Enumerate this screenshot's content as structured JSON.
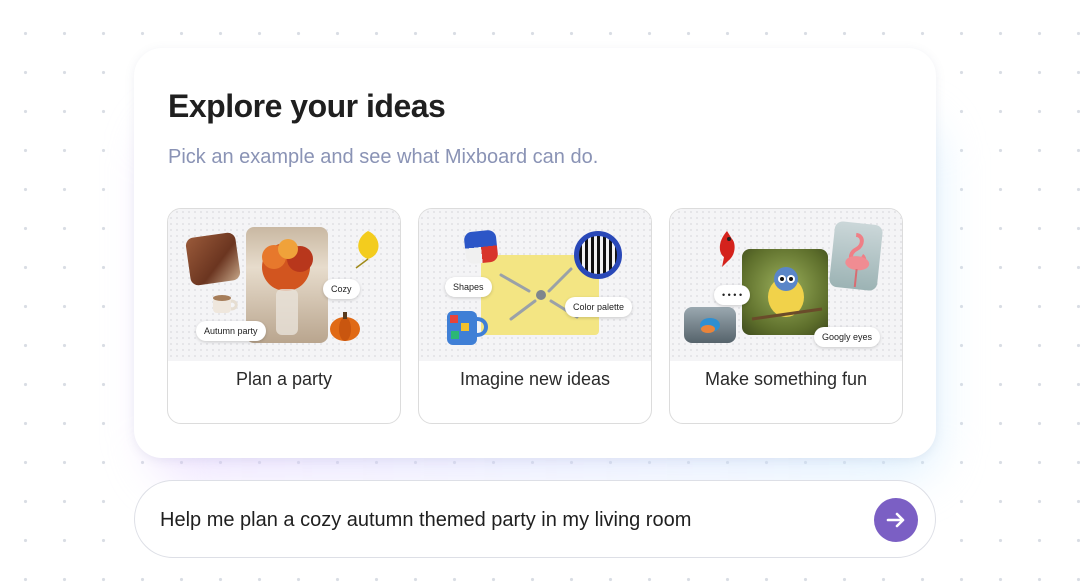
{
  "explore": {
    "title": "Explore your ideas",
    "subtitle": "Pick an example and see what Mixboard can do."
  },
  "examples": [
    {
      "label": "Plan a party",
      "chips": [
        "Cozy",
        "Autumn party"
      ]
    },
    {
      "label": "Imagine new ideas",
      "chips": [
        "Shapes",
        "Color palette"
      ]
    },
    {
      "label": "Make something fun",
      "chips": [
        "Googly eyes",
        "• • • •"
      ]
    }
  ],
  "prompt": {
    "value": "Help me plan a cozy autumn themed party in my living room",
    "send_icon": "arrow-right-icon",
    "accent_color": "#7b5fc4"
  }
}
